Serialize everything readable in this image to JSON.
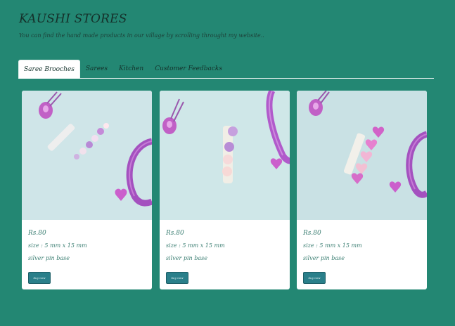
{
  "header": {
    "title": "KAUSHI STORES",
    "subtitle": "You can find the hand made products in our village by scrolling throught my website.."
  },
  "tabs": [
    {
      "label": "Saree Brooches",
      "active": true
    },
    {
      "label": "Sarees",
      "active": false
    },
    {
      "label": "Kitchen",
      "active": false
    },
    {
      "label": "Customer Feedbacks",
      "active": false
    }
  ],
  "products": [
    {
      "price": "Rs.80",
      "size": "size : 5 mm x 15 mm",
      "base": "silver pin base",
      "button": "buy now",
      "image": "brooch-photo-flowers"
    },
    {
      "price": "Rs.80",
      "size": "size : 5 mm x 15 mm",
      "base": "silver pin base",
      "button": "buy now",
      "image": "brooch-photo-lilac-flowers"
    },
    {
      "price": "Rs.80",
      "size": "size : 5 mm x 15 mm",
      "base": "silver pin base",
      "button": "buy now",
      "image": "brooch-photo-hearts"
    }
  ],
  "colors": {
    "page_background": "#238773",
    "card_background": "#ffffff",
    "text_accent": "#3b7e72",
    "button": "#2a7f8a"
  }
}
